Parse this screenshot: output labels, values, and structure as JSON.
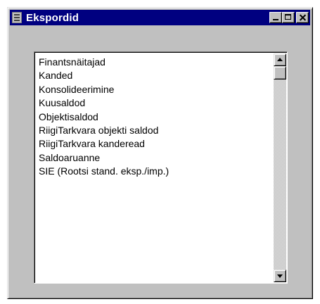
{
  "window": {
    "title": "Ekspordid"
  },
  "list": {
    "items": [
      "Finantsnäitajad",
      "Kanded",
      "Konsolideerimine",
      "Kuusaldod",
      "Objektisaldod",
      "RiigiTarkvara objekti saldod",
      "RiigiTarkvara kanderead",
      "Saldoaruanne",
      "SIE (Rootsi stand. eksp./imp.)"
    ]
  },
  "icons": {
    "app": "card-file-icon",
    "minimize": "minimize-icon",
    "maximize": "maximize-icon",
    "close": "close-icon",
    "scroll_up": "arrow-up-icon",
    "scroll_down": "arrow-down-icon"
  },
  "colors": {
    "titlebar": "#000080",
    "window_bg": "#c0c0c0",
    "list_bg": "#ffffff"
  }
}
